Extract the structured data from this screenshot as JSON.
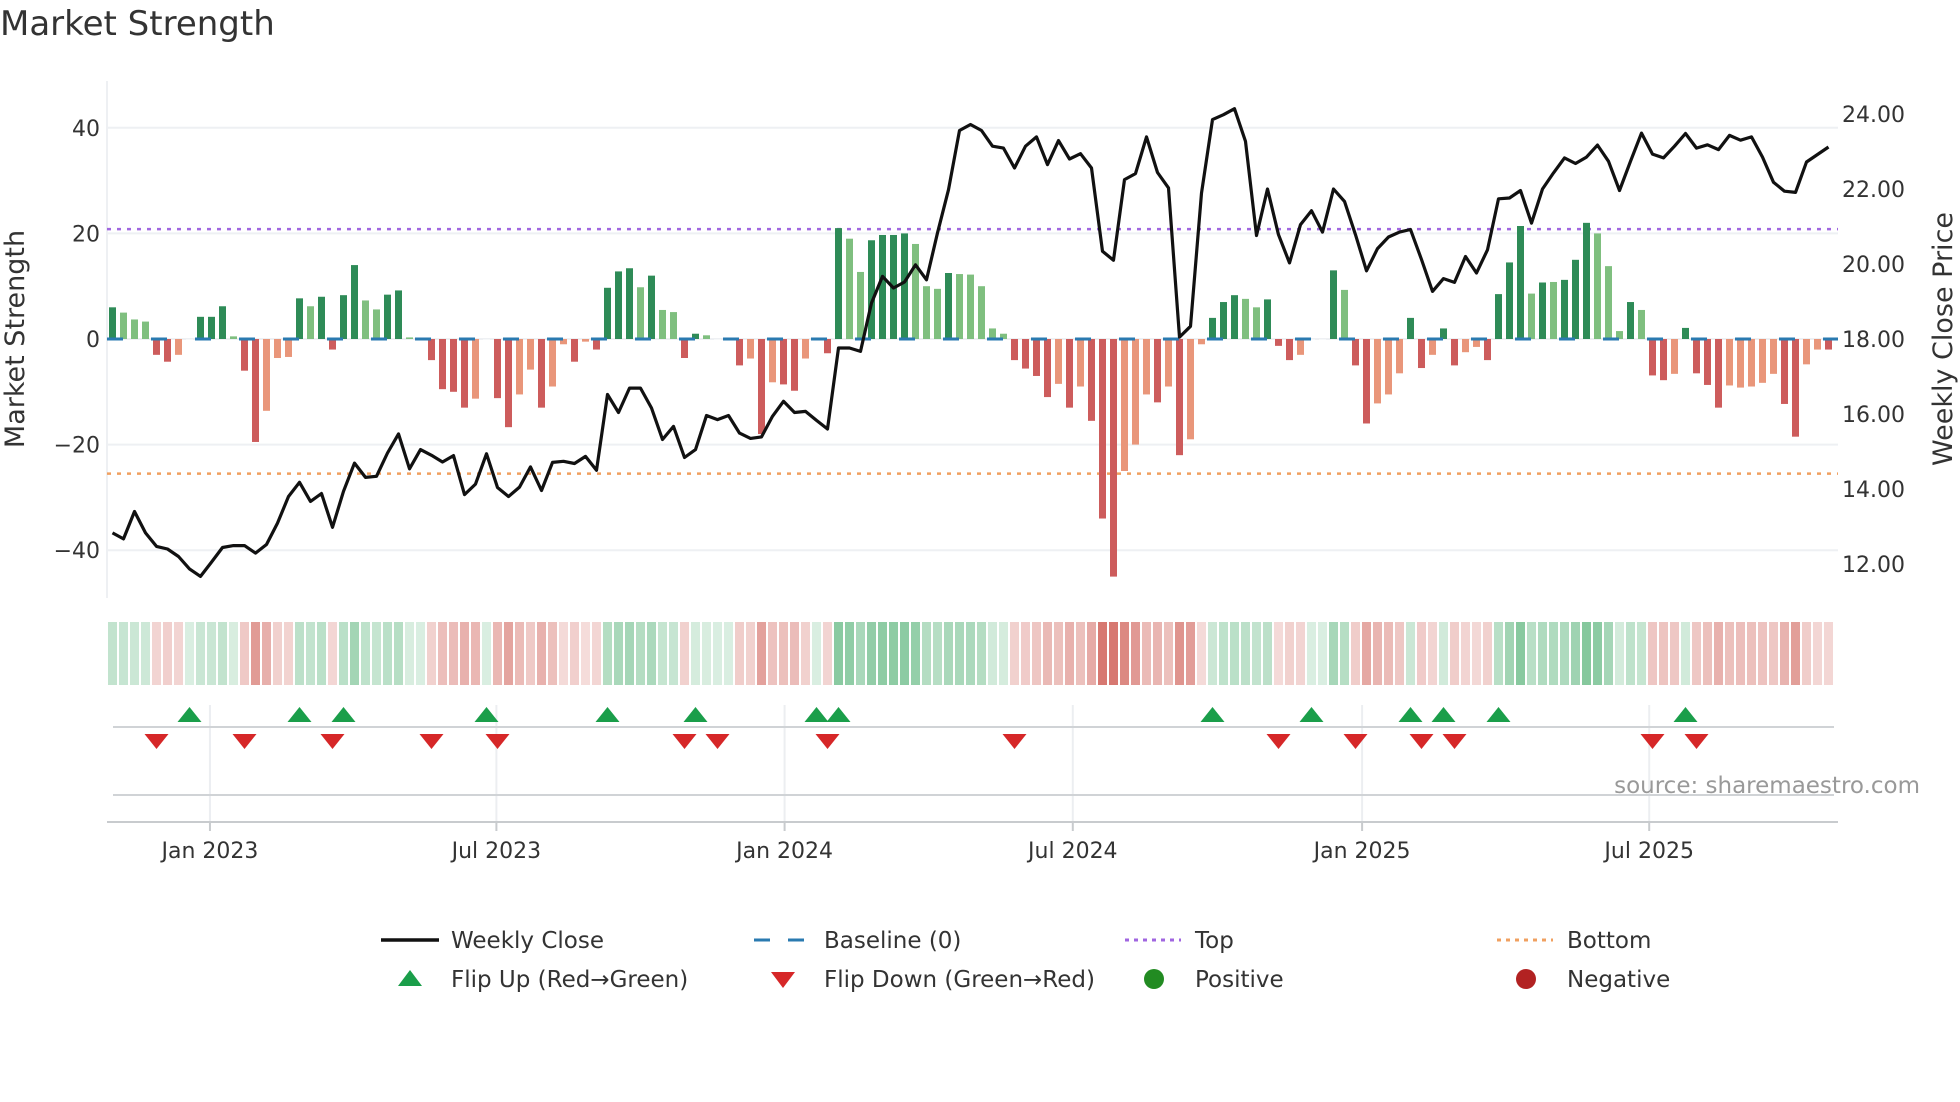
{
  "title": "Market Strength",
  "source": "source: sharemaestro.com",
  "chart_data": {
    "type": "bar",
    "title": "Market Strength",
    "ylabel": "Market Strength",
    "y2label": "Weekly Close Price",
    "ylim": [
      -50,
      50
    ],
    "y2lim": [
      11.0,
      25.0
    ],
    "yticks": [
      40,
      20,
      0,
      -20,
      -40
    ],
    "ytick_labels": [
      "40",
      "20",
      "0",
      "−20",
      "−40"
    ],
    "y2ticks": [
      24,
      22,
      20,
      18,
      16,
      14,
      12
    ],
    "y2tick_labels": [
      "24.00",
      "22.00",
      "20.00",
      "18.00",
      "16.00",
      "14.00",
      "12.00"
    ],
    "xticks": [
      {
        "week": 8.86,
        "label": "Jan 2023"
      },
      {
        "week": 34.9,
        "label": "Jul 2023"
      },
      {
        "week": 61.1,
        "label": "Jan 2024"
      },
      {
        "week": 87.3,
        "label": "Jul 2024"
      },
      {
        "week": 113.6,
        "label": "Jan 2025"
      },
      {
        "week": 139.7,
        "label": "Jul 2025"
      }
    ],
    "top_level": 20.8,
    "bottom_level": -25.5,
    "baseline": 0,
    "colors": {
      "strong_pos": "#2e8b57",
      "weak_pos": "#7fbf7f",
      "strong_neg": "#cd5c5c",
      "weak_neg": "#e9967a",
      "top": "#a066e0",
      "bottom": "#f0a060",
      "baseline": "#2a7ab0",
      "close": "#111111",
      "flip_up": "#1a9e4a",
      "flip_down": "#d62728",
      "positive": "#228b22",
      "negative": "#b22222"
    },
    "strength": [
      6,
      5,
      3.7,
      3.3,
      -3,
      -4.3,
      -3,
      0,
      4.2,
      4.2,
      6.2,
      0.5,
      -6,
      -19.5,
      -13.6,
      -3.6,
      -3.4,
      7.7,
      6.2,
      8,
      -2,
      8.3,
      14,
      7.3,
      5.6,
      8.4,
      9.2,
      0.3,
      0,
      -4,
      -9.5,
      -10,
      -13,
      -11.3,
      0,
      -11.2,
      -16.7,
      -10.5,
      -5.8,
      -13,
      -9,
      -1,
      -4.3,
      -0.5,
      -2,
      9.7,
      12.8,
      13.4,
      9.8,
      12,
      5.5,
      5.1,
      -3.6,
      1,
      0.7,
      0,
      0,
      -5,
      -3.7,
      -18,
      -8.2,
      -8.6,
      -9.8,
      -3.7,
      0,
      -2.7,
      21,
      19,
      12.7,
      18.7,
      19.7,
      19.7,
      20,
      18,
      10,
      9.5,
      12.5,
      12.3,
      12.2,
      10,
      2,
      1,
      -4,
      -5.6,
      -7,
      -11,
      -8.5,
      -13,
      -9,
      -15.5,
      -34,
      -45,
      -25,
      -20,
      -10.5,
      -12,
      -9,
      -22,
      -19,
      -1,
      4,
      7,
      8.3,
      7.6,
      6,
      7.5,
      -1.3,
      -4,
      -3,
      0,
      0,
      13,
      9.3,
      -5,
      -16,
      -12.2,
      -10.5,
      -6.5,
      4,
      -5.5,
      -3,
      2,
      -5,
      -2.5,
      -1.5,
      -4,
      8.5,
      14.5,
      21.4,
      8.6,
      10.7,
      10.8,
      11.2,
      15,
      22,
      20,
      13.8,
      1.5,
      7,
      5.5,
      -6.9,
      -7.8,
      -6.6,
      2.1,
      -6.5,
      -8.7,
      -13,
      -8.8,
      -9.2,
      -9,
      -8.3,
      -6.6,
      -12.3,
      -18.5,
      -4.8,
      -2,
      -2
    ],
    "shade": [
      "G",
      "g",
      "g",
      "g",
      "R",
      "R",
      "r",
      "n",
      "G",
      "G",
      "G",
      "g",
      "R",
      "R",
      "r",
      "r",
      "r",
      "G",
      "g",
      "G",
      "R",
      "G",
      "G",
      "g",
      "g",
      "G",
      "G",
      "g",
      "n",
      "R",
      "R",
      "R",
      "R",
      "r",
      "n",
      "R",
      "R",
      "r",
      "r",
      "R",
      "r",
      "r",
      "R",
      "r",
      "R",
      "G",
      "G",
      "G",
      "g",
      "G",
      "g",
      "g",
      "R",
      "G",
      "g",
      "n",
      "n",
      "R",
      "r",
      "R",
      "r",
      "R",
      "R",
      "r",
      "n",
      "R",
      "G",
      "g",
      "g",
      "G",
      "G",
      "G",
      "G",
      "g",
      "g",
      "g",
      "G",
      "g",
      "g",
      "g",
      "g",
      "g",
      "R",
      "R",
      "R",
      "R",
      "r",
      "R",
      "r",
      "R",
      "R",
      "R",
      "r",
      "r",
      "r",
      "R",
      "r",
      "R",
      "r",
      "r",
      "G",
      "G",
      "G",
      "g",
      "g",
      "G",
      "R",
      "R",
      "r",
      "n",
      "n",
      "G",
      "g",
      "R",
      "R",
      "r",
      "r",
      "r",
      "G",
      "R",
      "r",
      "G",
      "R",
      "r",
      "r",
      "R",
      "G",
      "G",
      "G",
      "g",
      "G",
      "g",
      "G",
      "G",
      "G",
      "g",
      "g",
      "g",
      "G",
      "g",
      "R",
      "R",
      "r",
      "G",
      "R",
      "R",
      "R",
      "r",
      "r",
      "r",
      "r",
      "r",
      "R",
      "R",
      "r",
      "r",
      "R"
    ],
    "weekly_close": [
      12.83,
      12.67,
      13.4,
      12.83,
      12.47,
      12.4,
      12.2,
      11.87,
      11.67,
      12.05,
      12.44,
      12.49,
      12.49,
      12.29,
      12.52,
      13.09,
      13.8,
      14.18,
      13.67,
      13.88,
      12.98,
      13.94,
      14.69,
      14.31,
      14.34,
      14.96,
      15.47,
      14.54,
      15.05,
      14.9,
      14.72,
      14.89,
      13.85,
      14.13,
      14.94,
      14.04,
      13.8,
      14.05,
      14.59,
      13.96,
      14.71,
      14.74,
      14.68,
      14.87,
      14.5,
      16.52,
      16.04,
      16.69,
      16.69,
      16.16,
      15.32,
      15.67,
      14.84,
      15.05,
      15.96,
      15.85,
      15.96,
      15.49,
      15.35,
      15.39,
      15.94,
      16.34,
      16.04,
      16.07,
      15.83,
      15.6,
      17.76,
      17.76,
      17.67,
      18.96,
      19.67,
      19.36,
      19.52,
      19.98,
      19.58,
      20.83,
      21.98,
      23.56,
      23.72,
      23.56,
      23.14,
      23.09,
      22.56,
      23.14,
      23.39,
      22.65,
      23.29,
      22.8,
      22.94,
      22.56,
      20.34,
      20.1,
      22.25,
      22.41,
      23.39,
      22.44,
      22.03,
      18.05,
      18.34,
      21.89,
      23.85,
      23.98,
      24.14,
      23.27,
      20.76,
      22.0,
      20.78,
      20.03,
      21.05,
      21.42,
      20.85,
      22.0,
      21.67,
      20.78,
      19.82,
      20.41,
      20.72,
      20.85,
      20.92,
      20.12,
      19.27,
      19.61,
      19.51,
      20.2,
      19.76,
      20.38,
      21.74,
      21.76,
      21.96,
      21.09,
      22.0,
      22.43,
      22.83,
      22.68,
      22.85,
      23.17,
      22.74,
      21.96,
      22.74,
      23.49,
      22.93,
      22.83,
      23.14,
      23.48,
      23.09,
      23.18,
      23.05,
      23.43,
      23.3,
      23.39,
      22.85,
      22.18,
      21.94,
      21.91,
      22.72,
      22.92,
      23.12
    ],
    "flip_up_weeks": [
      7,
      17,
      21,
      34,
      45,
      53,
      64,
      66,
      100,
      109,
      118,
      121,
      126,
      143
    ],
    "flip_down_weeks": [
      4,
      12,
      20,
      29,
      35,
      52,
      55,
      65,
      82,
      106,
      113,
      119,
      122,
      140,
      144
    ],
    "legend": {
      "placement": "bottom",
      "items": [
        {
          "key": "close",
          "label": "Weekly Close"
        },
        {
          "key": "baseline",
          "label": "Baseline (0)"
        },
        {
          "key": "top",
          "label": "Top"
        },
        {
          "key": "bottom",
          "label": "Bottom"
        },
        {
          "key": "flip_up",
          "label": "Flip Up (Red→Green)"
        },
        {
          "key": "flip_down",
          "label": "Flip Down (Green→Red)"
        },
        {
          "key": "positive",
          "label": "Positive"
        },
        {
          "key": "negative",
          "label": "Negative"
        }
      ]
    }
  }
}
